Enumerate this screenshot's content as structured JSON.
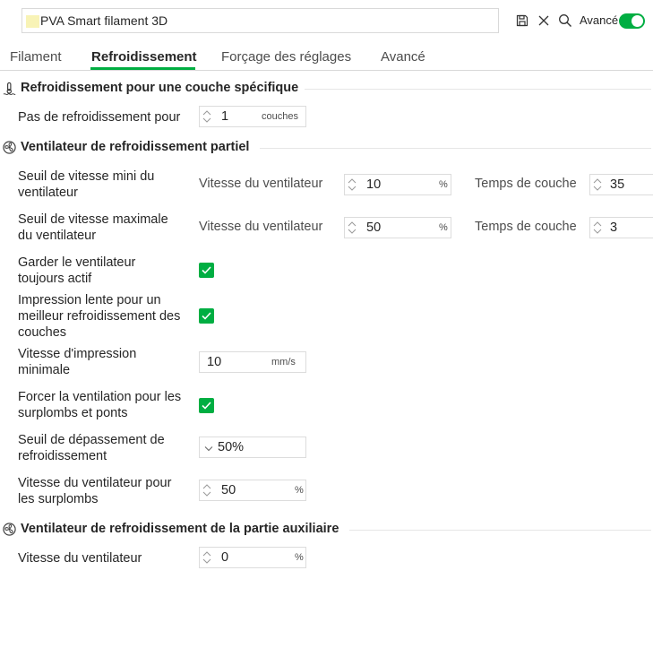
{
  "header": {
    "preset_name": "PVA Smart filament 3D",
    "swatch_color": "#f8f3b6",
    "mode_label": "Avancé",
    "mode_toggle_on": true,
    "accent_color": "#00ae42"
  },
  "tabs": [
    {
      "label": "Filament",
      "active": false
    },
    {
      "label": "Refroidissement",
      "active": true
    },
    {
      "label": "Forçage des réglages",
      "active": false
    },
    {
      "label": "Avancé",
      "active": false
    }
  ],
  "sections": {
    "specific_layer": {
      "title": "Refroidissement pour une couche spécifique",
      "icon": "thermometer-icon",
      "rows": {
        "cooling_layers": {
          "label": "Pas de refroidissement pour",
          "value": "1",
          "unit": "couches"
        }
      }
    },
    "part_fan": {
      "title": "Ventilateur de refroidissement partiel",
      "icon": "fan-icon",
      "rows": {
        "min_fan": {
          "label": "Seuil de vitesse mini du ventilateur",
          "speed_label": "Vitesse du ventilateur",
          "speed_value": "10",
          "speed_unit": "%",
          "time_label": "Temps de couche",
          "time_value": "35"
        },
        "max_fan": {
          "label": "Seuil de vitesse maximale du ventilateur",
          "speed_label": "Vitesse du ventilateur",
          "speed_value": "50",
          "speed_unit": "%",
          "time_label": "Temps de couche",
          "time_value": "3"
        },
        "keep_fan": {
          "label": "Garder le ventilateur toujours actif",
          "checked": true
        },
        "slow_down": {
          "label": "Impression lente pour un meilleur refroidissement des couches",
          "checked": true
        },
        "min_speed": {
          "label": "Vitesse d'impression minimale",
          "value": "10",
          "unit": "mm/s"
        },
        "force_overhang": {
          "label": "Forcer la ventilation pour les surplombs et ponts",
          "checked": true
        },
        "overhang_threshold": {
          "label": "Seuil de dépassement de refroidissement",
          "value": "50%"
        },
        "overhang_fan": {
          "label": "Vitesse du ventilateur pour les surplombs",
          "value": "50",
          "unit": "%"
        }
      }
    },
    "aux_fan": {
      "title": "Ventilateur de refroidissement de la partie auxiliaire",
      "icon": "fan-icon",
      "rows": {
        "fan_speed": {
          "label": "Vitesse du ventilateur",
          "value": "0",
          "unit": "%"
        }
      }
    }
  }
}
